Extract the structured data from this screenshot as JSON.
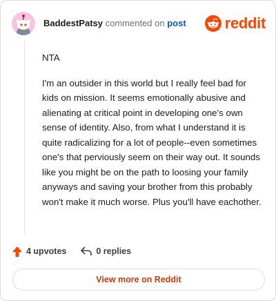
{
  "header": {
    "username": "BaddestPatsy",
    "action_text": "commented on",
    "post_link": "post",
    "brand": "reddit"
  },
  "comment": {
    "paragraphs": [
      "NTA",
      "I'm an outsider in this world but I really feel bad for kids on mission. It seems emotionally abusive and alienating at critical point in developing one's own sense of identity. Also, from what I understand it is quite radicalizing for a lot of people--even sometimes one's that perviously seem on their way out. It sounds like you might be on the path to loosing your family anyways and saving your brother from this probably won't make it much worse. Plus you'll have eachother."
    ]
  },
  "actions": {
    "upvotes_label": "4 upvotes",
    "replies_label": "0 replies"
  },
  "footer": {
    "view_more_label": "View more on Reddit"
  },
  "colors": {
    "brand": "#ff4500",
    "link": "#0b57c2",
    "button_text": "#c53a0a",
    "avatar_bg": "#f7c6de"
  },
  "icons": {
    "avatar": "snoo-avatar-icon",
    "logo": "reddit-snoo-icon",
    "upvote": "upvote-arrow-icon",
    "reply": "reply-arrow-icon"
  }
}
